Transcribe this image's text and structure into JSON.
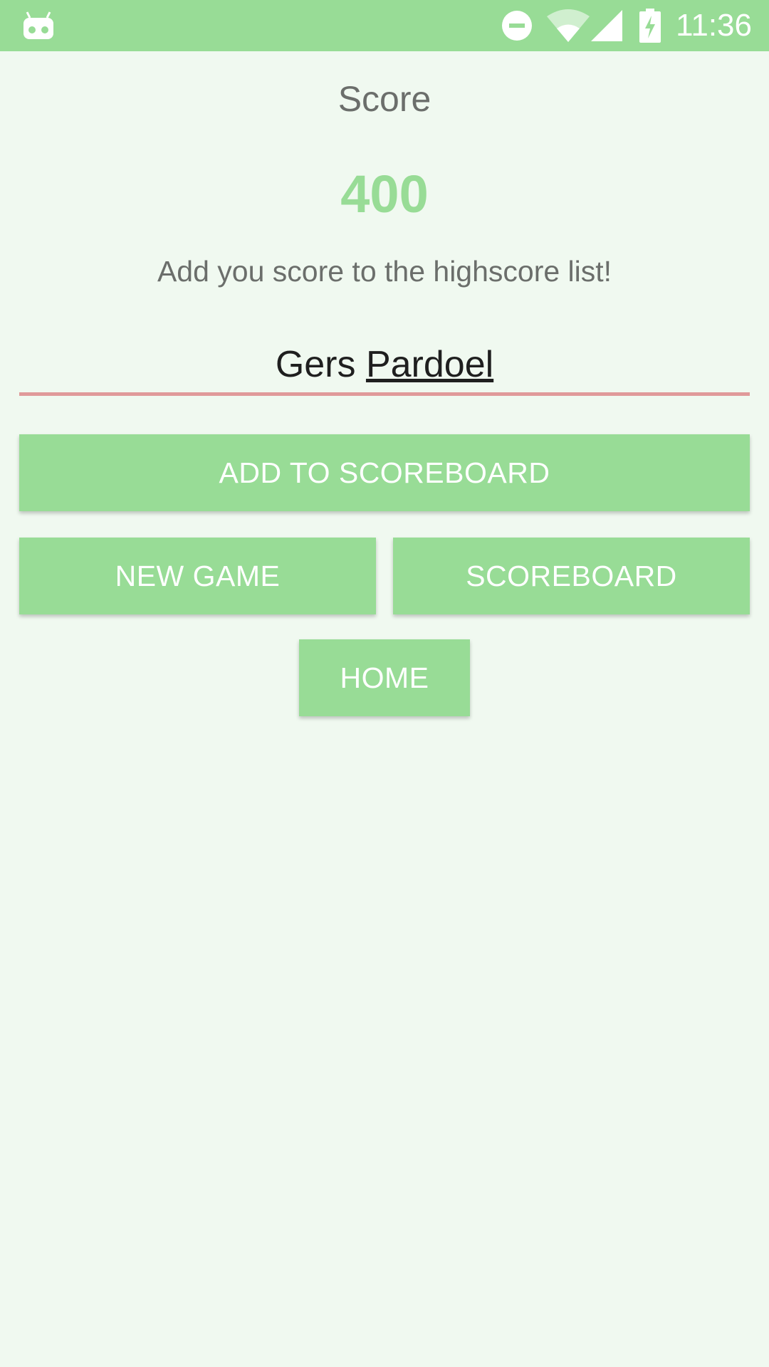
{
  "status_bar": {
    "time": "11:36",
    "icons": [
      "android-robot-icon",
      "do-not-disturb-icon",
      "wifi-icon",
      "cell-signal-icon",
      "battery-charging-icon"
    ]
  },
  "screen": {
    "title": "Score",
    "score": "400",
    "prompt": "Add you score to the highscore list!",
    "name_input": {
      "first": "Gers",
      "last": "Pardoel"
    }
  },
  "buttons": {
    "add_to_scoreboard": "ADD TO SCOREBOARD",
    "new_game": "NEW GAME",
    "scoreboard": "SCOREBOARD",
    "home": "HOME"
  },
  "colors": {
    "accent": "#98dc96",
    "background": "#f0f9f0",
    "input_underline": "#e09a9a",
    "text_secondary": "#6b6e6b"
  }
}
